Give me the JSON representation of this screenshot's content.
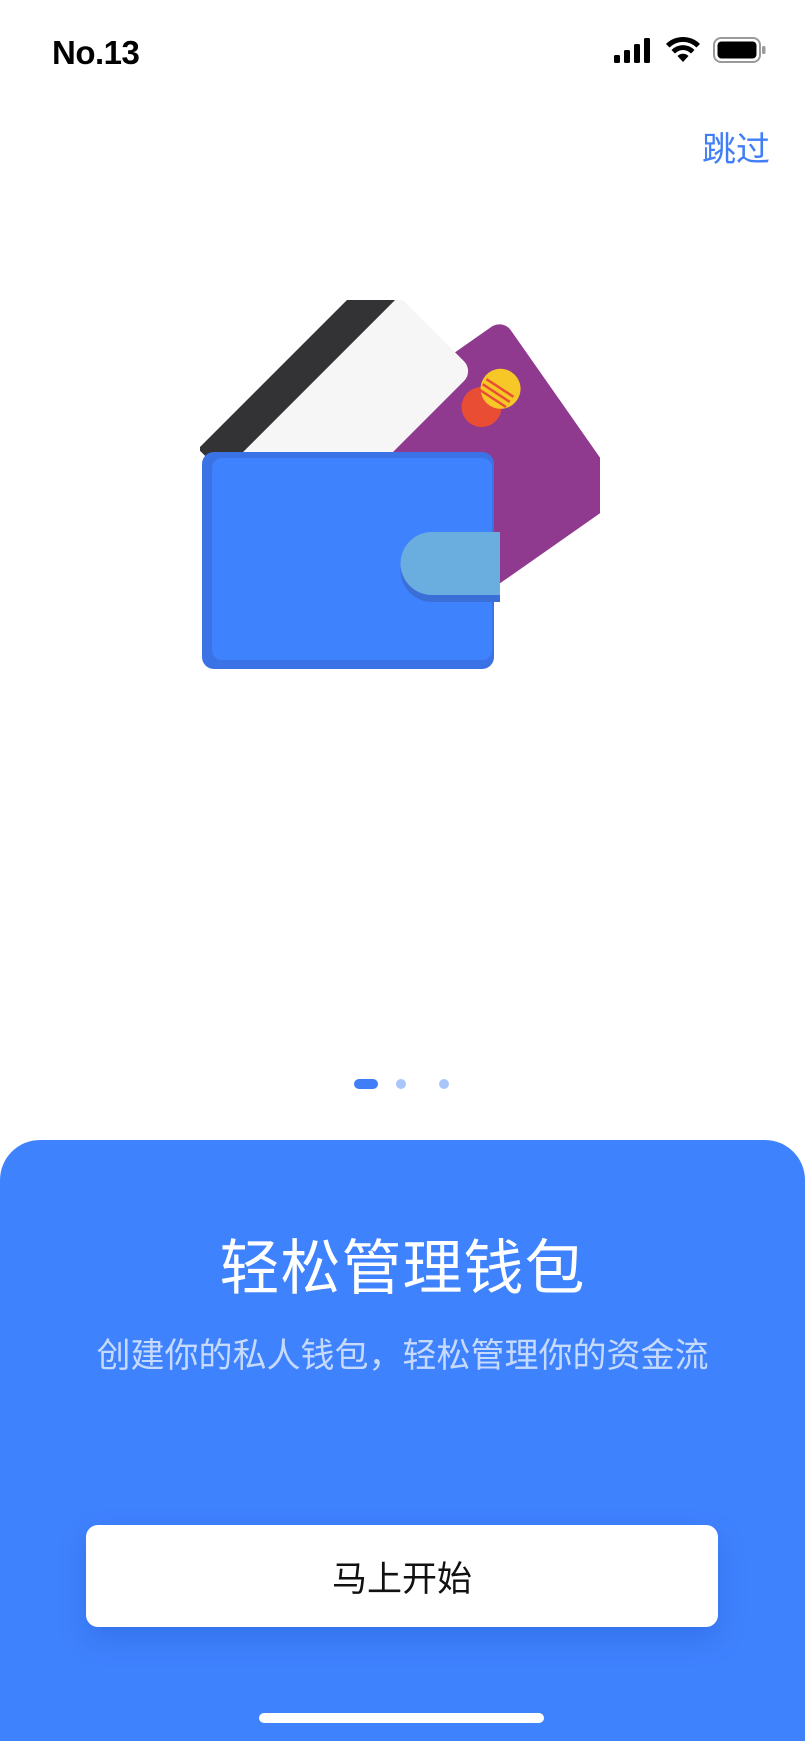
{
  "status_bar": {
    "time": "No.13",
    "icons": [
      "signal-icon",
      "wifi-icon",
      "battery-icon"
    ]
  },
  "header": {
    "skip_label": "跳过"
  },
  "illustration": {
    "icon": "wallet-with-cards-icon"
  },
  "pager": {
    "total": 3,
    "active_index": 0
  },
  "onboarding": {
    "title": "轻松管理钱包",
    "subtitle": "创建你的私人钱包，轻松管理你的资金流",
    "start_button_label": "马上开始"
  },
  "colors": {
    "accent": "#3f82fe",
    "link": "#3f7ef6",
    "dot_inactive": "#a9c6fb",
    "card_purple": "#8f3a8e",
    "card_white": "#f6f6f6",
    "wallet_blue": "#3f82fe",
    "wallet_clasp": "#6aaee0"
  }
}
